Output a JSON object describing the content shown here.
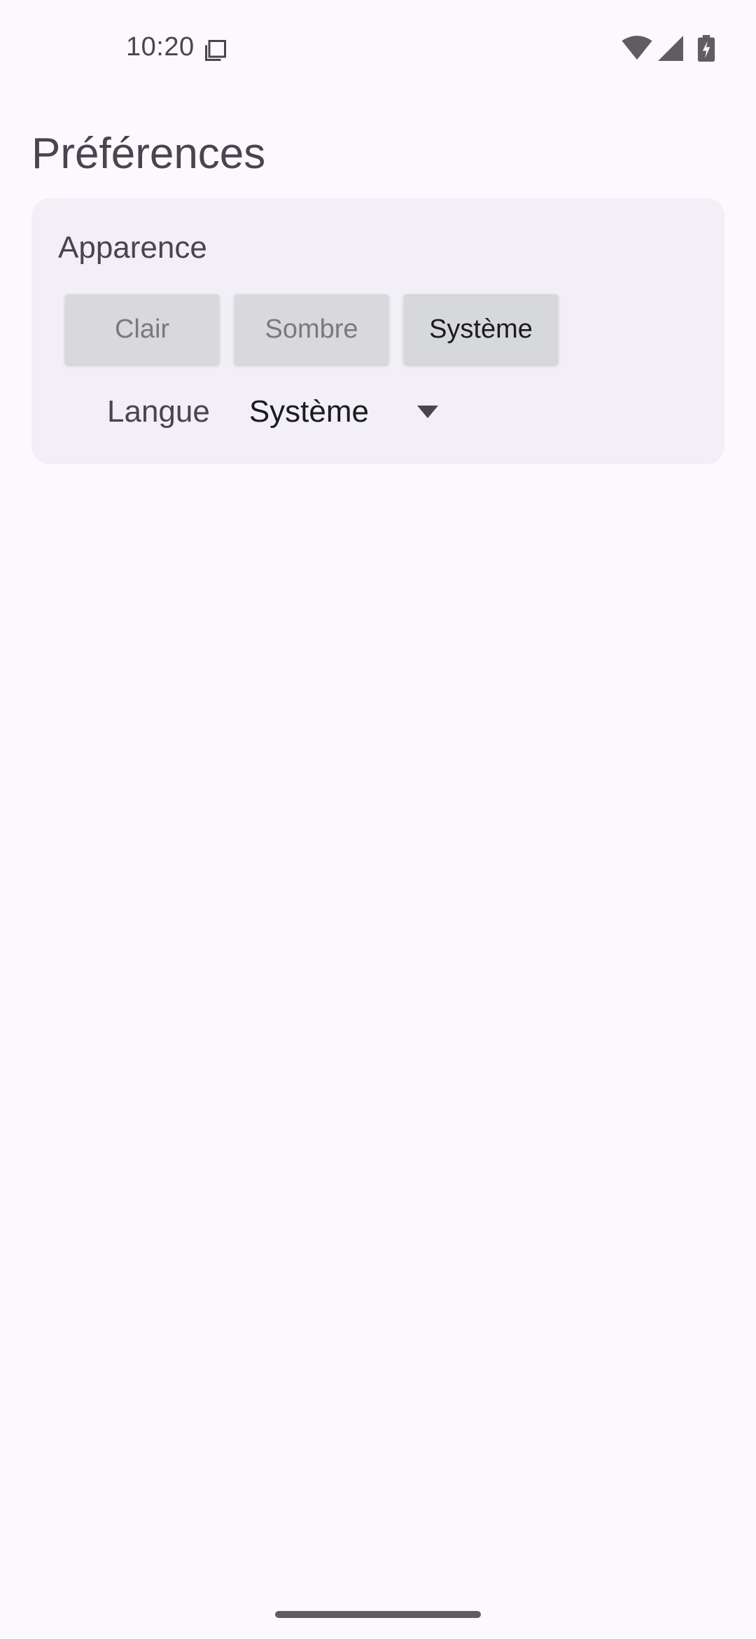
{
  "status_bar": {
    "time": "10:20",
    "notification_icon": "screenshot-icon",
    "icons": [
      "wifi-icon",
      "signal-icon",
      "battery-charging-icon"
    ]
  },
  "page": {
    "title": "Préférences"
  },
  "appearance": {
    "label": "Apparence",
    "options": [
      {
        "label": "Clair",
        "selected": false
      },
      {
        "label": "Sombre",
        "selected": false
      },
      {
        "label": "Système",
        "selected": true
      }
    ]
  },
  "language": {
    "label": "Langue",
    "value": "Système"
  },
  "colors": {
    "background": "#fdf8fd",
    "card": "#f2eff6",
    "text_secondary": "#49454f"
  }
}
